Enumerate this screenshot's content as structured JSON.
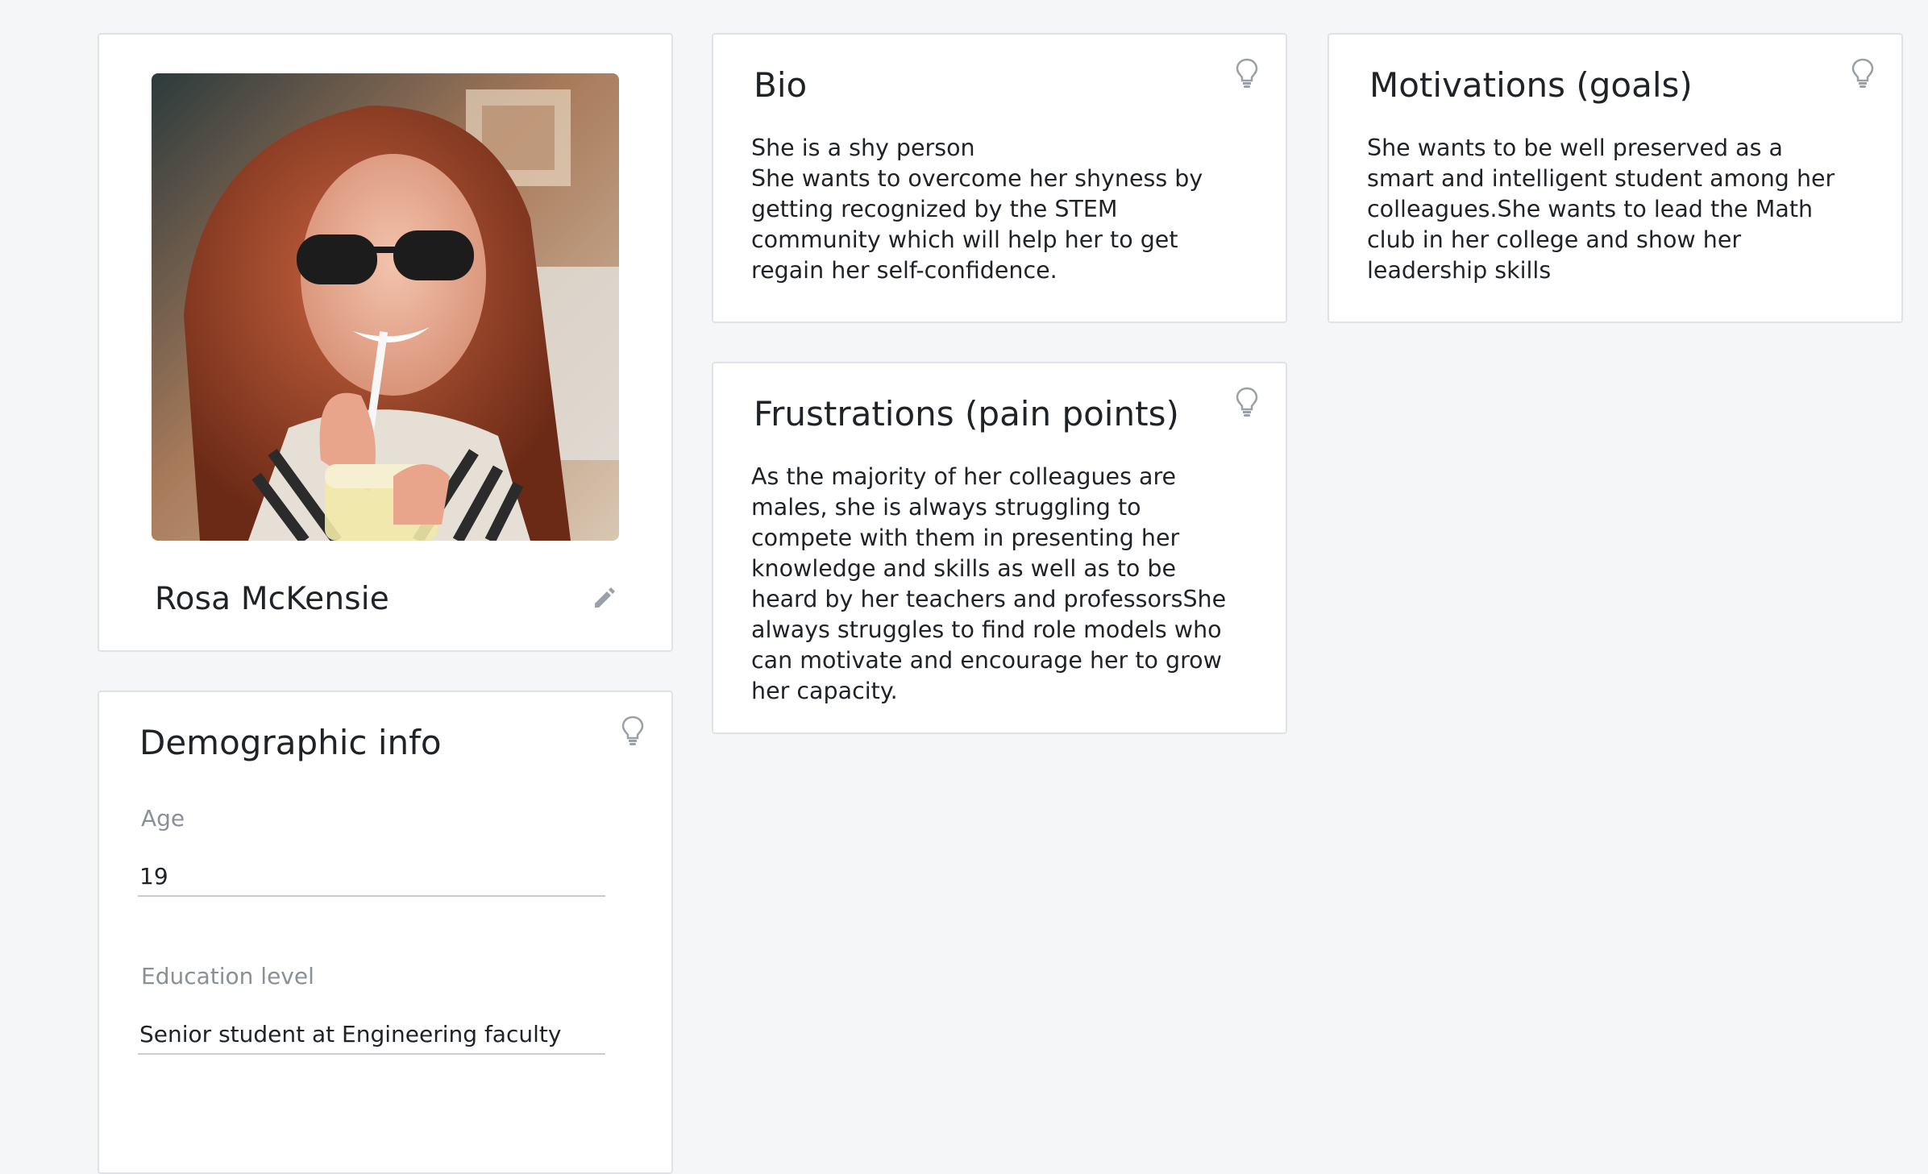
{
  "profile": {
    "name": "Rosa McKensie",
    "photo_icon": "persona-photo",
    "edit_icon": "pencil-icon"
  },
  "bio": {
    "title": "Bio",
    "text": "She is a shy person\nShe wants to overcome her shyness by getting recognized by the STEM community which will help her to get regain her self-confidence."
  },
  "motivations": {
    "title": "Motivations (goals)",
    "text": "She wants to be well preserved as a smart and intelligent student among her colleagues.She wants to lead the Math club in her college and show her leadership skills"
  },
  "frustrations": {
    "title": "Frustrations (pain points)",
    "text": "As the majority of her colleagues are males, she is always struggling to compete with them in presenting her knowledge and skills as well as to be heard by her teachers and professorsShe always struggles to find role models who can motivate and encourage her to grow her capacity."
  },
  "demographic": {
    "title": "Demographic info",
    "age_label": "Age",
    "age_value": "19",
    "education_label": "Education level",
    "education_value": "Senior student at Engineering faculty"
  },
  "icons": {
    "hint": "lightbulb-icon",
    "edit": "pencil-icon"
  },
  "colors": {
    "background": "#f5f6f8",
    "card_border": "#dfe3e8",
    "text": "#1f2328",
    "muted": "#8a9098",
    "icon": "#9aa0a6"
  }
}
